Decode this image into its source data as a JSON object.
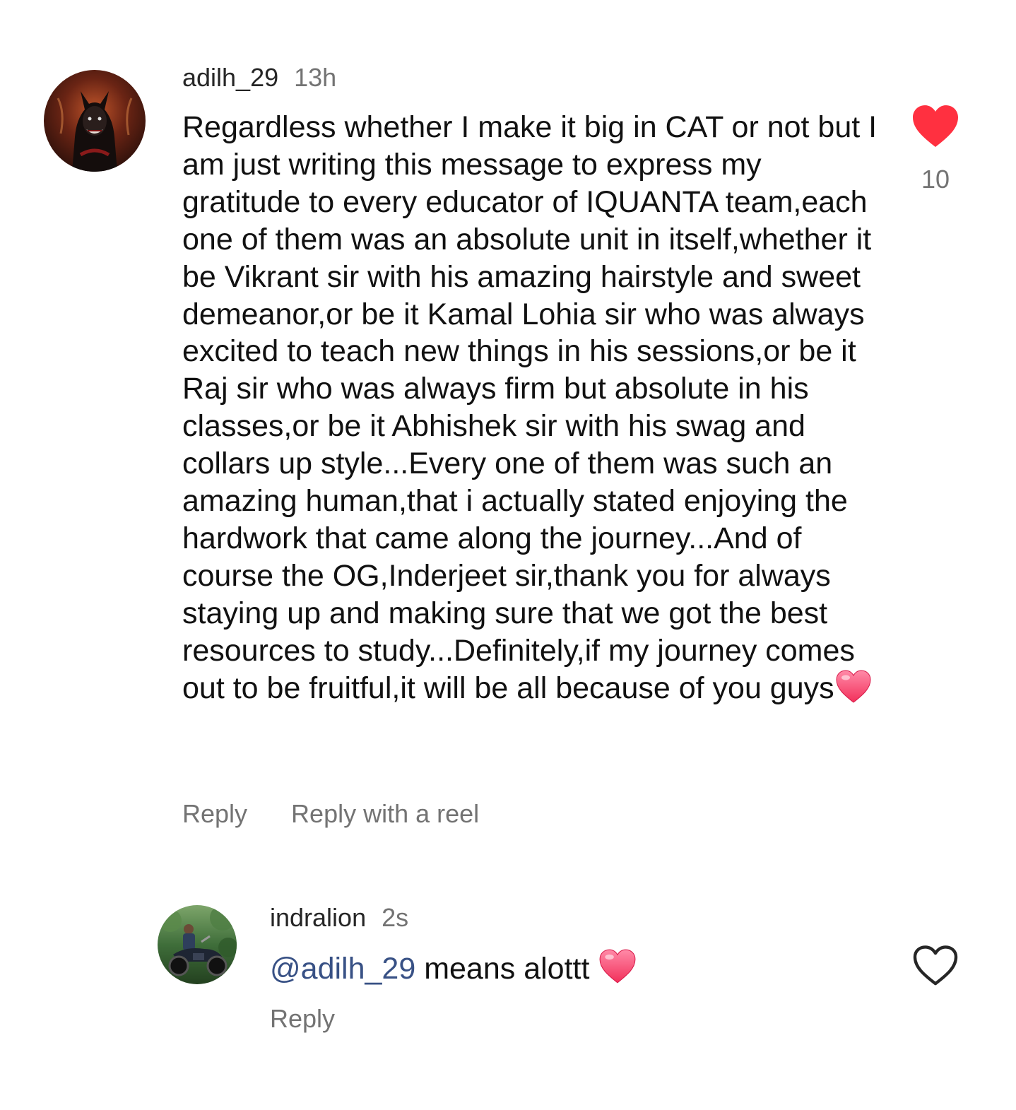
{
  "comment": {
    "username": "adilh_29",
    "timestamp": "13h",
    "text": "Regardless whether I make it big in CAT or not but I am just writing this message to express my gratitude to every educator of IQUANTA team,each one of them was an absolute unit in itself,whether it be Vikrant sir with his amazing hairstyle and sweet demeanor,or be it Kamal Lohia sir who was always excited to teach new things in his sessions,or be it Raj sir who was always firm but absolute in his classes,or be it Abhishek sir with his swag and collars up style...Every one of them was such an amazing human,that i actually stated enjoying the hardwork that came along the journey...And of course the OG,Inderjeet sir,thank you for always staying up and making sure that we got the best resources to study...Definitely,if my journey comes out to be fruitful,it will be all because of you guys",
    "trailing_emoji": "pink-heart-emoji",
    "like_count": "10",
    "liked": true,
    "like_icon": "heart-filled-icon",
    "like_color": "#ff3040",
    "actions": {
      "reply": "Reply",
      "reply_with_reel": "Reply with a reel"
    }
  },
  "reply": {
    "username": "indralion",
    "timestamp": "2s",
    "mention": "@adilh_29",
    "text": " means alottt ",
    "trailing_emoji": "pink-heart-emoji",
    "liked": false,
    "like_icon": "heart-outline-icon",
    "actions": {
      "reply": "Reply"
    }
  },
  "colors": {
    "mention": "#385185",
    "secondary_text": "#737373"
  }
}
